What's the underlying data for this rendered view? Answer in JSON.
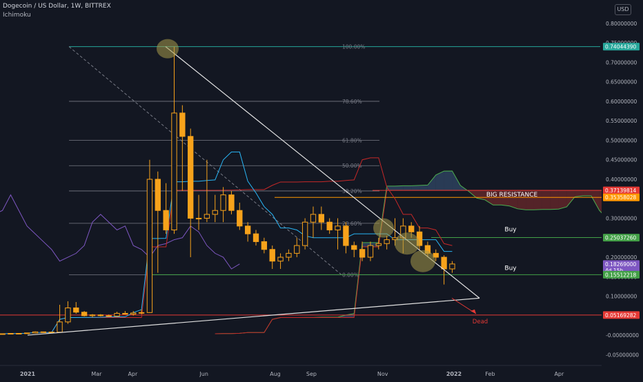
{
  "header": {
    "title": "Dogecoin / US Dollar, 1W, BITTREX",
    "indicator": "Ichimoku",
    "currency_button": "USD"
  },
  "chart_data": {
    "type": "candlestick",
    "symbol": "Dogecoin / US Dollar",
    "interval": "1W",
    "exchange": "BITTREX",
    "y_axis": {
      "range": [
        -0.06,
        0.86
      ],
      "ticks": [
        "0.80000000",
        "0.75000000",
        "0.70000000",
        "0.65000000",
        "0.60000000",
        "0.55000000",
        "0.50000000",
        "0.45000000",
        "0.40000000",
        "0.35000000",
        "0.30000000",
        "0.25000000",
        "0.20000000",
        "0.15000000",
        "0.10000000",
        "0.05000000",
        "-0.00000000",
        "-0.05000000"
      ]
    },
    "x_axis": {
      "ticks": [
        "2021",
        "Mar",
        "Apr",
        "Jun",
        "Aug",
        "Sep",
        "Nov",
        "2022",
        "Feb",
        "Apr"
      ]
    },
    "grid": false,
    "candles": [
      {
        "date": "2020-12-07",
        "o": 0.0037,
        "h": 0.004,
        "l": 0.0034,
        "c": 0.0036
      },
      {
        "date": "2020-12-14",
        "o": 0.0036,
        "h": 0.0048,
        "l": 0.0035,
        "c": 0.0045
      },
      {
        "date": "2020-12-21",
        "o": 0.0045,
        "h": 0.005,
        "l": 0.004,
        "c": 0.0046
      },
      {
        "date": "2020-12-28",
        "o": 0.0046,
        "h": 0.006,
        "l": 0.0044,
        "c": 0.0057
      },
      {
        "date": "2021-01-04",
        "o": 0.0057,
        "h": 0.01,
        "l": 0.005,
        "c": 0.0085
      },
      {
        "date": "2021-01-11",
        "o": 0.0085,
        "h": 0.009,
        "l": 0.007,
        "c": 0.008
      },
      {
        "date": "2021-01-18",
        "o": 0.008,
        "h": 0.0085,
        "l": 0.0074,
        "c": 0.0077
      },
      {
        "date": "2021-01-25",
        "o": 0.0077,
        "h": 0.078,
        "l": 0.007,
        "c": 0.034
      },
      {
        "date": "2021-02-01",
        "o": 0.034,
        "h": 0.087,
        "l": 0.029,
        "c": 0.07
      },
      {
        "date": "2021-02-08",
        "o": 0.07,
        "h": 0.085,
        "l": 0.055,
        "c": 0.059
      },
      {
        "date": "2021-02-15",
        "o": 0.059,
        "h": 0.062,
        "l": 0.048,
        "c": 0.05
      },
      {
        "date": "2021-02-22",
        "o": 0.05,
        "h": 0.054,
        "l": 0.046,
        "c": 0.052
      },
      {
        "date": "2021-03-01",
        "o": 0.052,
        "h": 0.054,
        "l": 0.048,
        "c": 0.05
      },
      {
        "date": "2021-03-08",
        "o": 0.05,
        "h": 0.053,
        "l": 0.047,
        "c": 0.049
      },
      {
        "date": "2021-03-15",
        "o": 0.049,
        "h": 0.06,
        "l": 0.047,
        "c": 0.056
      },
      {
        "date": "2021-03-22",
        "o": 0.056,
        "h": 0.062,
        "l": 0.053,
        "c": 0.054
      },
      {
        "date": "2021-03-29",
        "o": 0.054,
        "h": 0.062,
        "l": 0.05,
        "c": 0.057
      },
      {
        "date": "2021-04-05",
        "o": 0.057,
        "h": 0.066,
        "l": 0.054,
        "c": 0.058
      },
      {
        "date": "2021-04-12",
        "o": 0.058,
        "h": 0.45,
        "l": 0.057,
        "c": 0.4
      },
      {
        "date": "2021-04-19",
        "o": 0.4,
        "h": 0.42,
        "l": 0.16,
        "c": 0.32
      },
      {
        "date": "2021-04-26",
        "o": 0.32,
        "h": 0.39,
        "l": 0.26,
        "c": 0.27
      },
      {
        "date": "2021-05-03",
        "o": 0.27,
        "h": 0.74,
        "l": 0.26,
        "c": 0.57
      },
      {
        "date": "2021-05-10",
        "o": 0.57,
        "h": 0.59,
        "l": 0.37,
        "c": 0.51
      },
      {
        "date": "2021-05-17",
        "o": 0.51,
        "h": 0.53,
        "l": 0.2,
        "c": 0.3
      },
      {
        "date": "2021-05-24",
        "o": 0.3,
        "h": 0.36,
        "l": 0.27,
        "c": 0.3
      },
      {
        "date": "2021-05-31",
        "o": 0.3,
        "h": 0.45,
        "l": 0.29,
        "c": 0.31
      },
      {
        "date": "2021-06-07",
        "o": 0.31,
        "h": 0.36,
        "l": 0.29,
        "c": 0.32
      },
      {
        "date": "2021-06-14",
        "o": 0.32,
        "h": 0.38,
        "l": 0.29,
        "c": 0.36
      },
      {
        "date": "2021-06-21",
        "o": 0.36,
        "h": 0.37,
        "l": 0.31,
        "c": 0.32
      },
      {
        "date": "2021-06-28",
        "o": 0.32,
        "h": 0.34,
        "l": 0.27,
        "c": 0.28
      },
      {
        "date": "2021-07-05",
        "o": 0.28,
        "h": 0.29,
        "l": 0.24,
        "c": 0.26
      },
      {
        "date": "2021-07-12",
        "o": 0.26,
        "h": 0.27,
        "l": 0.23,
        "c": 0.24
      },
      {
        "date": "2021-07-19",
        "o": 0.24,
        "h": 0.25,
        "l": 0.21,
        "c": 0.22
      },
      {
        "date": "2021-07-26",
        "o": 0.22,
        "h": 0.23,
        "l": 0.17,
        "c": 0.19
      },
      {
        "date": "2021-08-02",
        "o": 0.19,
        "h": 0.21,
        "l": 0.17,
        "c": 0.2
      },
      {
        "date": "2021-08-09",
        "o": 0.2,
        "h": 0.22,
        "l": 0.19,
        "c": 0.21
      },
      {
        "date": "2021-08-16",
        "o": 0.21,
        "h": 0.25,
        "l": 0.2,
        "c": 0.23
      },
      {
        "date": "2021-08-23",
        "o": 0.23,
        "h": 0.3,
        "l": 0.22,
        "c": 0.29
      },
      {
        "date": "2021-08-30",
        "o": 0.29,
        "h": 0.33,
        "l": 0.25,
        "c": 0.31
      },
      {
        "date": "2021-09-06",
        "o": 0.31,
        "h": 0.33,
        "l": 0.27,
        "c": 0.29
      },
      {
        "date": "2021-09-13",
        "o": 0.29,
        "h": 0.3,
        "l": 0.26,
        "c": 0.27
      },
      {
        "date": "2021-09-20",
        "o": 0.27,
        "h": 0.3,
        "l": 0.22,
        "c": 0.28
      },
      {
        "date": "2021-09-27",
        "o": 0.28,
        "h": 0.29,
        "l": 0.21,
        "c": 0.23
      },
      {
        "date": "2021-10-04",
        "o": 0.23,
        "h": 0.24,
        "l": 0.2,
        "c": 0.22
      },
      {
        "date": "2021-10-11",
        "o": 0.22,
        "h": 0.24,
        "l": 0.19,
        "c": 0.2
      },
      {
        "date": "2021-10-18",
        "o": 0.2,
        "h": 0.24,
        "l": 0.19,
        "c": 0.23
      },
      {
        "date": "2021-10-25",
        "o": 0.23,
        "h": 0.25,
        "l": 0.22,
        "c": 0.235
      },
      {
        "date": "2021-11-01",
        "o": 0.235,
        "h": 0.255,
        "l": 0.22,
        "c": 0.245
      },
      {
        "date": "2021-11-08",
        "o": 0.245,
        "h": 0.3,
        "l": 0.23,
        "c": 0.25
      },
      {
        "date": "2021-11-15",
        "o": 0.25,
        "h": 0.3,
        "l": 0.21,
        "c": 0.28
      },
      {
        "date": "2021-11-22",
        "o": 0.28,
        "h": 0.29,
        "l": 0.25,
        "c": 0.265
      },
      {
        "date": "2021-11-29",
        "o": 0.265,
        "h": 0.28,
        "l": 0.22,
        "c": 0.23
      },
      {
        "date": "2021-12-06",
        "o": 0.23,
        "h": 0.24,
        "l": 0.2,
        "c": 0.21
      },
      {
        "date": "2021-12-13",
        "o": 0.21,
        "h": 0.22,
        "l": 0.19,
        "c": 0.2
      },
      {
        "date": "2021-12-20",
        "o": 0.2,
        "h": 0.205,
        "l": 0.13,
        "c": 0.17
      },
      {
        "date": "2021-12-27",
        "o": 0.17,
        "h": 0.19,
        "l": 0.16,
        "c": 0.1827
      }
    ],
    "fibonacci_retracement": {
      "levels": [
        {
          "label": "100.00%",
          "value": 0.7404
        },
        {
          "label": "78.60%",
          "value": 0.6
        },
        {
          "label": "61.80%",
          "value": 0.5
        },
        {
          "label": "50.00%",
          "value": 0.435
        },
        {
          "label": "38.20%",
          "value": 0.37
        },
        {
          "label": "23.60%",
          "value": 0.287
        },
        {
          "label": "0.00%",
          "value": 0.155
        }
      ]
    },
    "price_labels": [
      {
        "value": "0.74044390",
        "color": "#26a69a"
      },
      {
        "value": "0.37139814",
        "color": "#e53935"
      },
      {
        "value": "0.35358028",
        "color": "#ff9800"
      },
      {
        "value": "0.25037260",
        "color": "#43a047"
      },
      {
        "value": "0.18269000",
        "sub": "4d 15h",
        "color": "#7e57c2"
      },
      {
        "value": "0.15512218",
        "color": "#43a047"
      },
      {
        "value": "0.05169282",
        "color": "#e53935"
      }
    ],
    "annotations": [
      "BIG RESISTANCE",
      "Buy",
      "Buy",
      "Dead"
    ],
    "colors": {
      "background": "#131722",
      "candle": "#f7a21b",
      "fib": "#787b86",
      "red_line": "#e53935",
      "green_line": "#43a047",
      "orange_line": "#ff9800",
      "teal_line": "#26a69a",
      "kijun": "#c62828",
      "tenkan": "#29b6f6",
      "chikou": "#7e57c2",
      "cloud_bear": "#8b2e2e",
      "cloud_bull": "#3d5a80"
    }
  }
}
